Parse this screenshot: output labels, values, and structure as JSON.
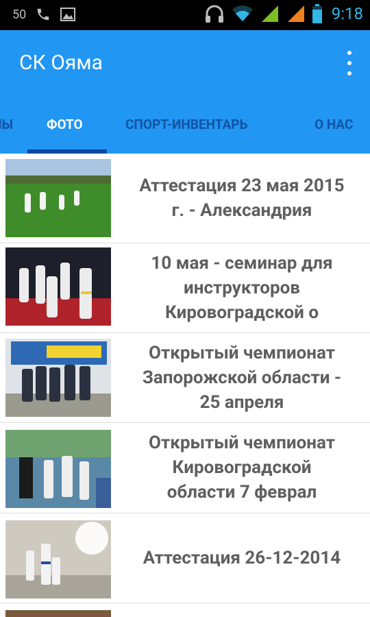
{
  "status_bar": {
    "notification_count": "50",
    "time": "9:18",
    "icons": [
      "phone-icon",
      "image-icon",
      "headphones-icon",
      "wifi-icon",
      "signal-icon",
      "signal-roaming-icon",
      "battery-icon"
    ],
    "colors": {
      "background": "#000000",
      "time": "#33b5e5",
      "signal_green": "#7cc023",
      "signal_orange": "#f0801f"
    }
  },
  "app_bar": {
    "title": "СК Ояма",
    "overflow_icon": "more-vert-icon",
    "background": "#2196f3"
  },
  "tabs": [
    {
      "label": "ЫЫ",
      "active": false
    },
    {
      "label": "ФОТО",
      "active": true
    },
    {
      "label": "СПОРТ-ИНВЕНТАРЬ",
      "active": false
    },
    {
      "label": "О НАС",
      "active": false
    }
  ],
  "list": {
    "items": [
      {
        "title_lines": [
          "Аттестация 23 мая 2015",
          "г. - Александрия"
        ],
        "thumbnail": "outdoor-karate-field-photo"
      },
      {
        "title_lines": [
          "10 мая - семинар для",
          "инструкторов",
          "Кировоградской о"
        ],
        "thumbnail": "dojo-seminar-photo"
      },
      {
        "title_lines": [
          "Открытый чемпионат",
          "Запорожской области -",
          "25 апреля"
        ],
        "thumbnail": "group-outdoor-photo"
      },
      {
        "title_lines": [
          "Открытый чемпионат",
          "Кировоградской",
          "области 7 феврал"
        ],
        "thumbnail": "championship-podium-photo"
      },
      {
        "title_lines": [
          "Аттестация 26-12-2014"
        ],
        "thumbnail": "indoor-attestation-photo"
      }
    ]
  }
}
